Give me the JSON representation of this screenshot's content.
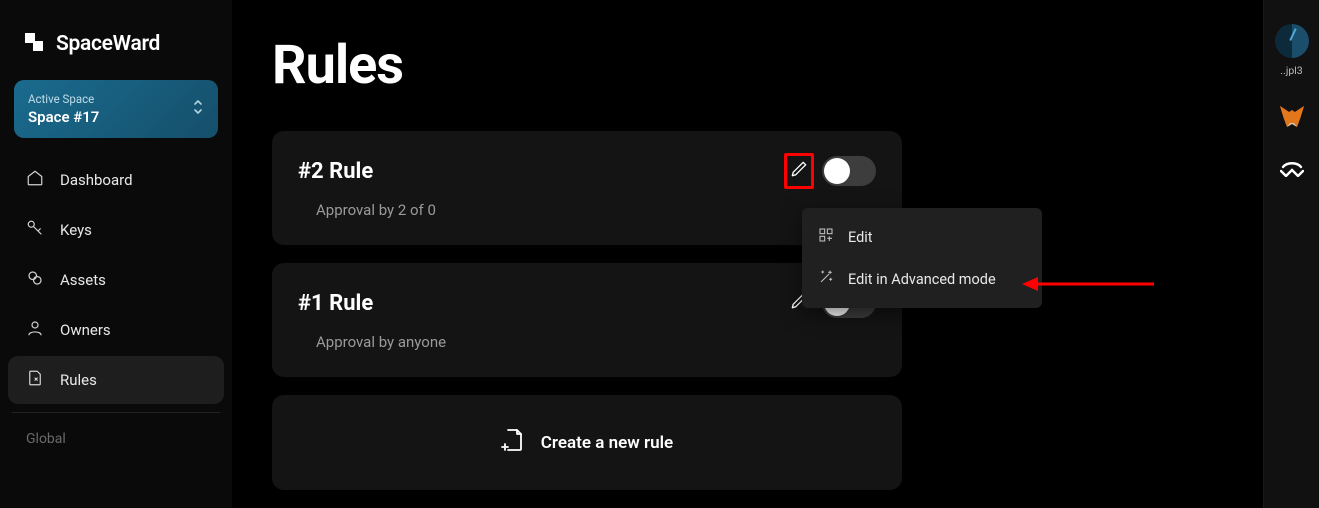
{
  "brand": {
    "title": "SpaceWard"
  },
  "space_selector": {
    "label": "Active Space",
    "name": "Space #17"
  },
  "sidebar": {
    "items": [
      {
        "label": "Dashboard"
      },
      {
        "label": "Keys"
      },
      {
        "label": "Assets"
      },
      {
        "label": "Owners"
      },
      {
        "label": "Rules"
      }
    ],
    "section_label": "Global"
  },
  "page": {
    "title": "Rules"
  },
  "rules": [
    {
      "title": "#2 Rule",
      "subtitle": "Approval by 2 of 0"
    },
    {
      "title": "#1 Rule",
      "subtitle": "Approval by anyone"
    }
  ],
  "create": {
    "label": "Create a new rule"
  },
  "dropdown": {
    "items": [
      {
        "label": "Edit"
      },
      {
        "label": "Edit in Advanced mode"
      }
    ]
  },
  "rail": {
    "user_label": "..jpl3"
  }
}
